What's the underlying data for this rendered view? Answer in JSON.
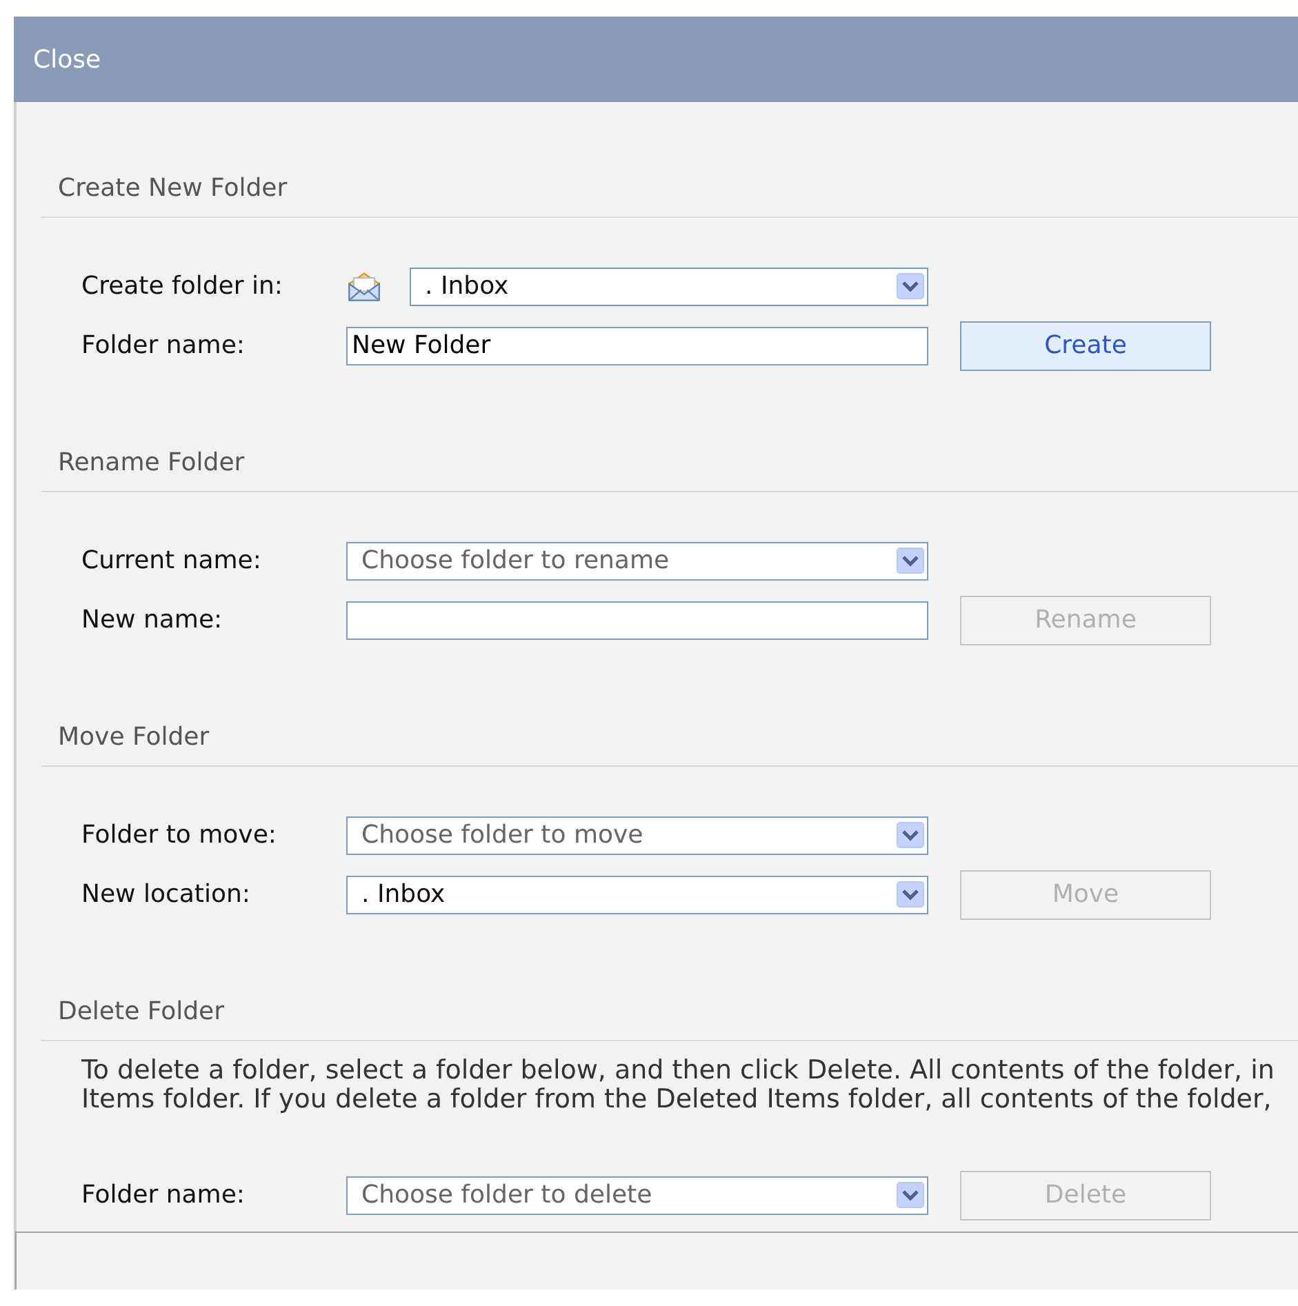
{
  "header": {
    "title": "Close"
  },
  "sections": [
    {
      "title": "Create New Folder",
      "rows": [
        {
          "label": "Create folder in:",
          "control": {
            "kind": "picker",
            "value": ". Inbox",
            "dimmed": false
          }
        },
        {
          "label": "Folder name:",
          "control": {
            "kind": "text",
            "value": "New Folder"
          },
          "button": {
            "label": "Create",
            "disabled": false
          }
        }
      ]
    },
    {
      "title": "Rename Folder",
      "rows": [
        {
          "label": "Current name:",
          "control": {
            "kind": "dropdown",
            "value": "Choose folder to rename",
            "dimmed": true
          }
        },
        {
          "label": "New name:",
          "control": {
            "kind": "text"
          },
          "button": {
            "label": "Rename",
            "disabled": true
          }
        }
      ]
    },
    {
      "title": "Move Folder",
      "rows": [
        {
          "label": "Folder to move:",
          "control": {
            "kind": "dropdown",
            "value": "Choose folder to move",
            "dimmed": true
          }
        },
        {
          "label": "New location:",
          "control": {
            "kind": "dropdown",
            "value": ". Inbox",
            "dimmed": false
          },
          "button": {
            "label": "Move",
            "disabled": true
          }
        }
      ]
    },
    {
      "title": "Delete Folder",
      "description": [
        "To delete a folder, select a folder below, and then click Delete. All contents of the folder, in",
        "Items folder. If you delete a folder from the Deleted Items folder, all contents of the folder,"
      ],
      "rows": [
        {
          "label": "Folder name:",
          "control": {
            "kind": "dropdown",
            "value": "Choose folder to delete",
            "dimmed": true
          },
          "button": {
            "label": "Delete",
            "disabled": true
          }
        }
      ]
    }
  ]
}
